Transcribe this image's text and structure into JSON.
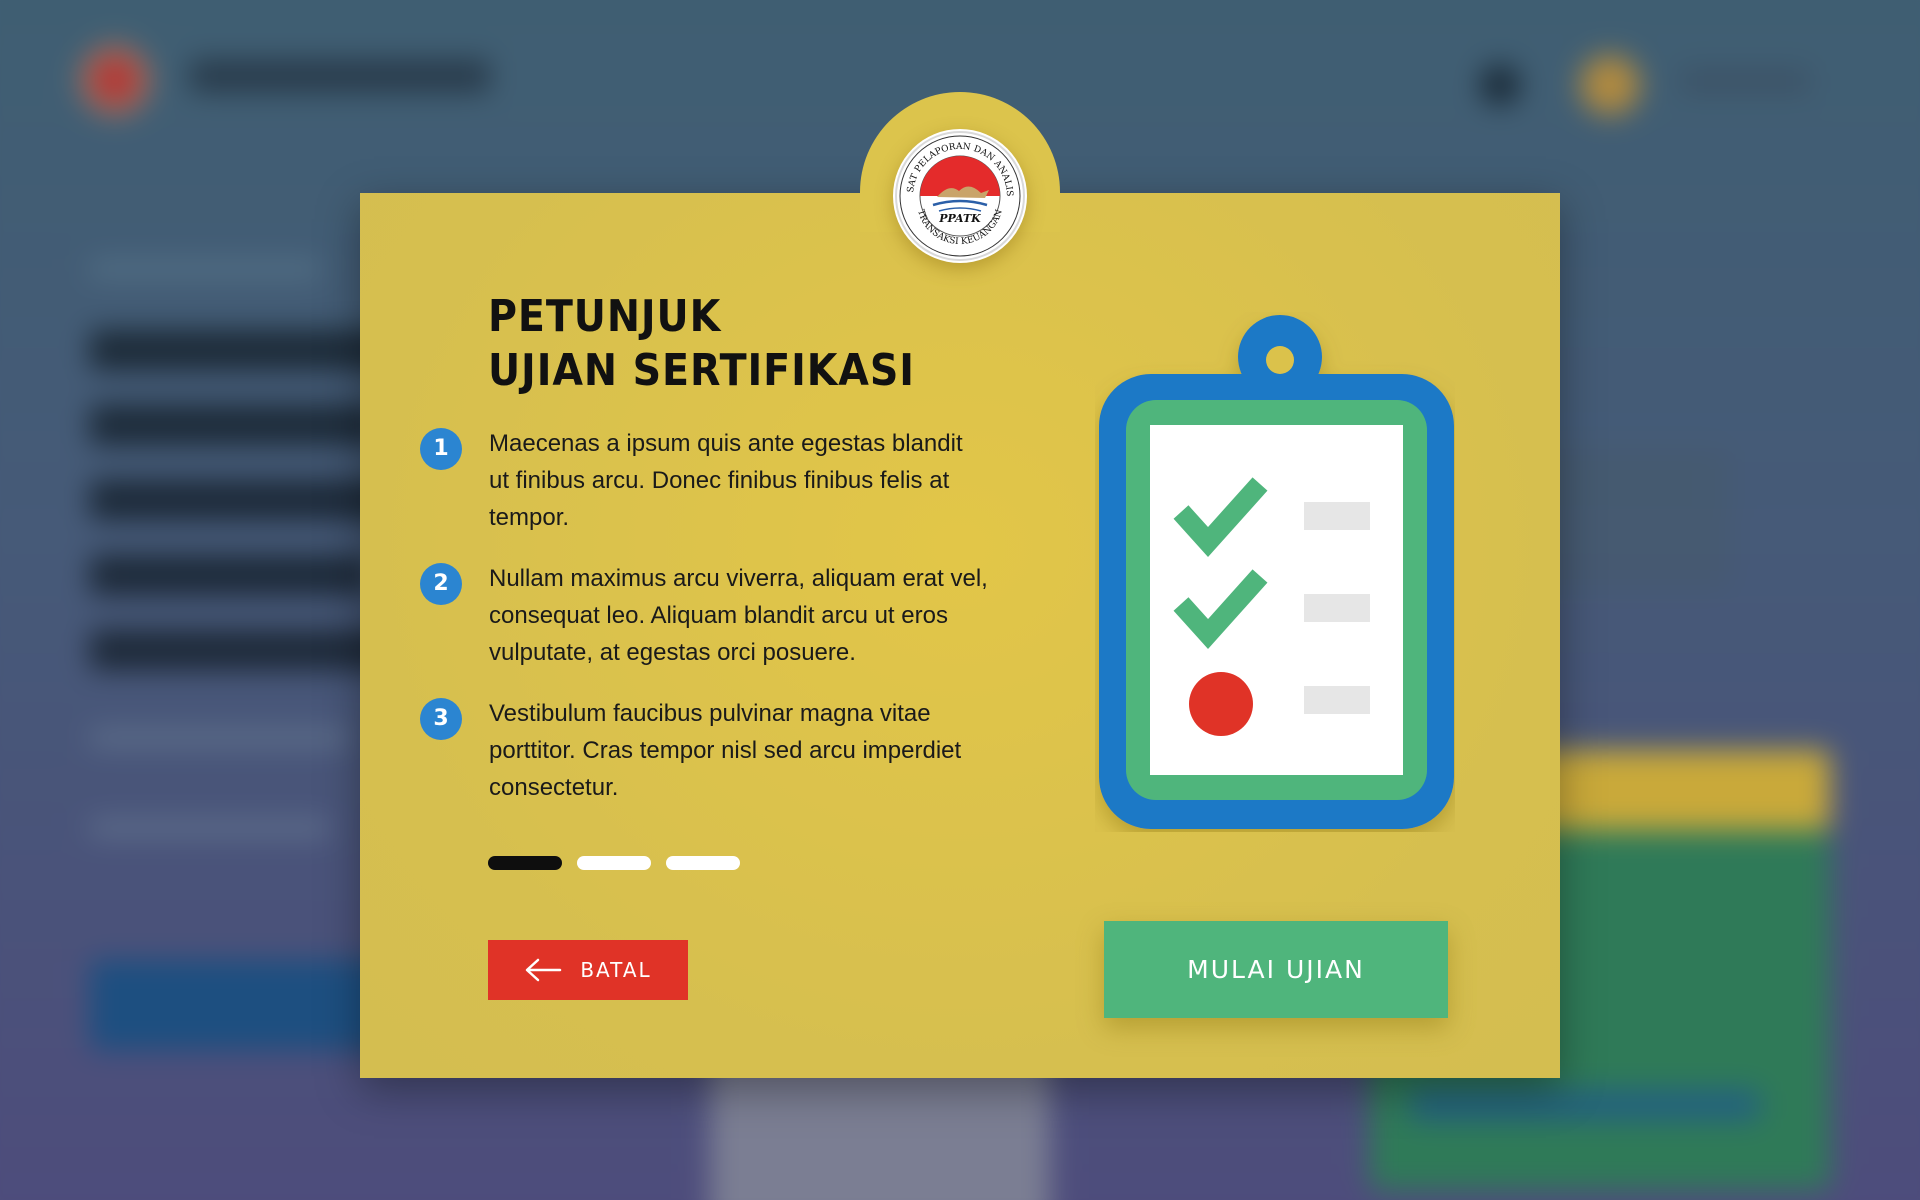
{
  "modal": {
    "seal": {
      "text_top": "PUSAT PELAPORAN DAN ANALISIS",
      "text_bottom": "TRANSAKSI KEUANGAN",
      "text_center": "PPATK"
    },
    "title_line1": "PETUNJUK",
    "title_line2": "UJIAN SERTIFIKASI",
    "steps": [
      {
        "number": "1",
        "text": "Maecenas a ipsum quis ante egestas blandit ut finibus arcu. Donec finibus finibus felis at tempor."
      },
      {
        "number": "2",
        "text": "Nullam maximus arcu viverra, aliquam erat vel, consequat leo. Aliquam blandit arcu ut eros vulputate, at egestas orci posuere."
      },
      {
        "number": "3",
        "text": "Vestibulum faucibus pulvinar magna vitae porttitor. Cras tempor nisl sed arcu imperdiet consectetur."
      }
    ],
    "pagination": {
      "total": 3,
      "active": 1
    },
    "cancel_label": "BATAL",
    "start_label": "MULAI UJIAN",
    "checklist": [
      {
        "state": "checked",
        "icon": "check-icon"
      },
      {
        "state": "checked",
        "icon": "check-icon"
      },
      {
        "state": "pending",
        "icon": "red-dot-icon"
      }
    ]
  },
  "colors": {
    "modal_bg": "#dbc24c",
    "step_badge": "#2b85d1",
    "cancel_button": "#e03327",
    "start_button": "#4fb57c",
    "clipboard_frame": "#1a79c6",
    "clipboard_inner": "#4fb57c",
    "check": "#4fb57c",
    "pending_dot": "#e03327"
  }
}
